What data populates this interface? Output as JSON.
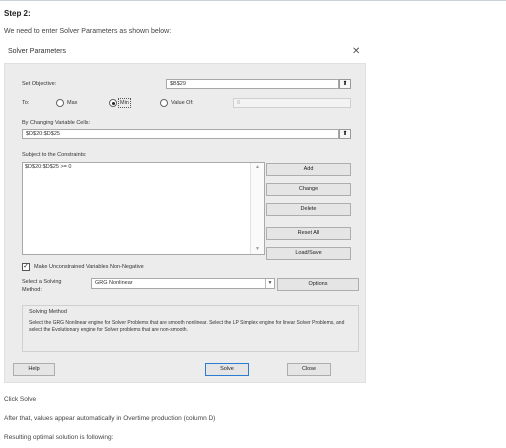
{
  "doc": {
    "step_heading": "Step 2:",
    "intro": "We need to enter Solver Parameters as shown below:",
    "click_solve": "Click Solve",
    "after_note": "After that, values appear automatically in Overtime production (column D)",
    "result_note": "Resulting optimal solution is following:"
  },
  "dialog": {
    "title": "Solver Parameters",
    "close_icon": "close-icon",
    "objective_label": "Set Objective:",
    "objective_value": "$B$29",
    "to_label": "To:",
    "max_label": "Max",
    "min_label": "Min",
    "value_of_label": "Value Of:",
    "value_of_value": "0",
    "selected_goal": "Min",
    "changing_label": "By Changing Variable Cells:",
    "changing_value": "$D$20:$D$25",
    "ref_icon": "range-select-icon",
    "constraints_label": "Subject to the Constraints:",
    "constraints": [
      "$D$20:$D$25 >= 0"
    ],
    "buttons": {
      "add": "Add",
      "change": "Change",
      "delete": "Delete",
      "reset_all": "Reset All",
      "load_save": "Load/Save",
      "options": "Options",
      "help": "Help",
      "solve": "Solve",
      "close": "Close"
    },
    "unconstrained_label": "Make Unconstrained Variables Non-Negative",
    "unconstrained_checked": true,
    "method_label_1": "Select a Solving",
    "method_label_2": "Method:",
    "method_value": "GRG Nonlinear",
    "solving_method_title": "Solving Method",
    "solving_method_text": "Select the GRG Nonlinear engine for Solver Problems that are smooth nonlinear. Select the LP Simplex engine for linear Solver Problems, and select the Evolutionary engine for Solver problems that are non-smooth."
  }
}
